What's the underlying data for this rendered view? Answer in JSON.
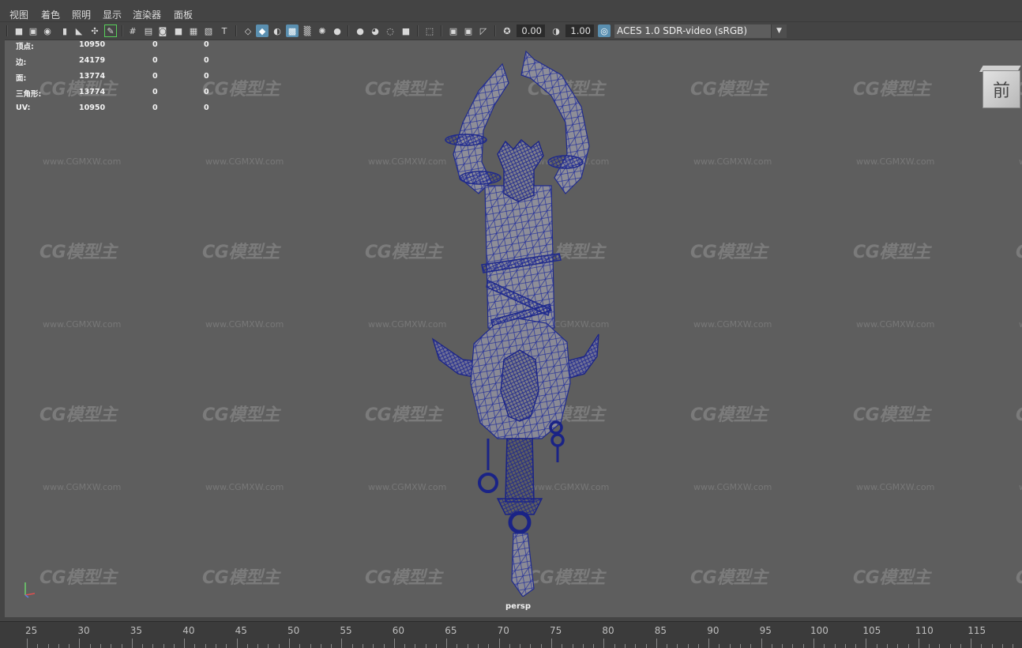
{
  "menu": [
    "视图",
    "着色",
    "照明",
    "显示",
    "渲染器",
    "面板"
  ],
  "toolbar": {
    "icons_left": [
      "camera-icon",
      "camera-attr-icon",
      "bookmark-icon",
      "image-plane-icon",
      "grease-pencil-icon",
      "2d-pan-icon",
      "pencil-icon"
    ],
    "icons_middle": [
      "grid-icon",
      "film-gate-icon",
      "resolution-gate-icon",
      "gate-mask-icon",
      "field-chart-icon",
      "safe-action-icon",
      "safe-title-icon",
      "wireframe-icon",
      "smooth-shade-icon",
      "default-material-icon",
      "wireframe-on-shaded-icon",
      "textured-icon",
      "use-all-lights-icon",
      "shadows-icon",
      "screen-space-ao-icon",
      "motion-blur-icon",
      "multisample-aa-icon",
      "depth-of-field-icon",
      "isolate-select-icon",
      "xray-icon",
      "xray-active-icon",
      "xray-joints-icon",
      "backface-icon"
    ],
    "exposure_value": "0.00",
    "gamma_value": "1.00",
    "color_space": "ACES 1.0 SDR-video (sRGB)"
  },
  "hud": {
    "rows": [
      {
        "label": "顶点:",
        "a": "10950",
        "b": "0",
        "c": "0"
      },
      {
        "label": "边:",
        "a": "24179",
        "b": "0",
        "c": "0"
      },
      {
        "label": "面:",
        "a": "13774",
        "b": "0",
        "c": "0"
      },
      {
        "label": "三角形:",
        "a": "13774",
        "b": "0",
        "c": "0"
      },
      {
        "label": "UV:",
        "a": "10950",
        "b": "0",
        "c": "0"
      }
    ]
  },
  "viewcube_label": "前",
  "camera_label": "persp",
  "watermark": {
    "logo": "CG模型主",
    "url": "www.CGMXW.com"
  },
  "timeline": [
    "25",
    "30",
    "35",
    "40",
    "45",
    "50",
    "55",
    "60",
    "65",
    "70",
    "75",
    "80",
    "85",
    "90",
    "95",
    "100",
    "105",
    "110",
    "115"
  ],
  "colors": {
    "wire": "#1f2a8c",
    "mesh_fill": "#8d8d96",
    "viewport_bg": "#5e5e5e"
  }
}
